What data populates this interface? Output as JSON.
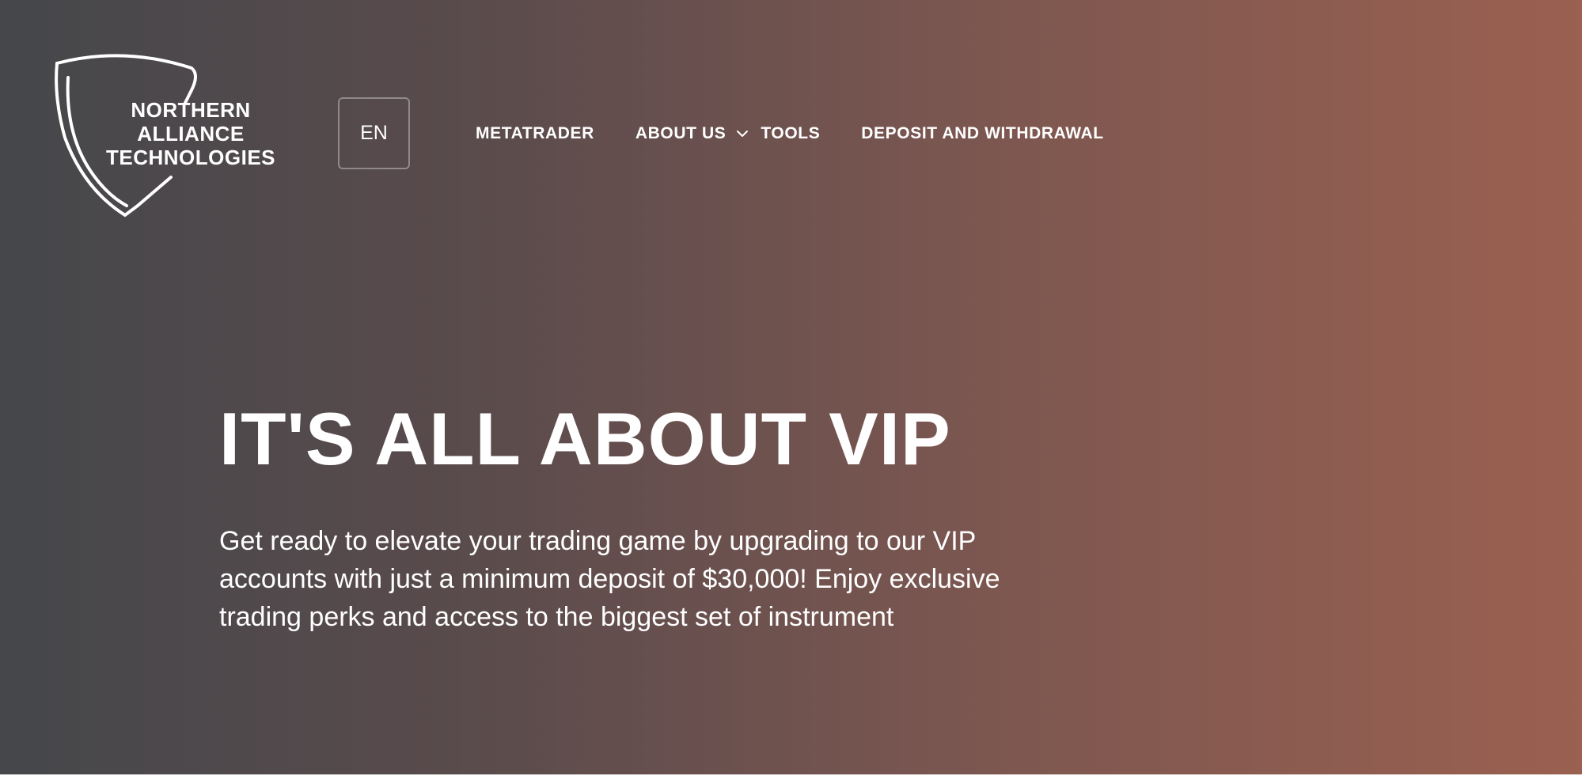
{
  "brand": {
    "lines": [
      "NORTHERN",
      "ALLIANCE",
      "TECHNOLOGIES"
    ],
    "icon": "shield-icon"
  },
  "language": {
    "label": "EN"
  },
  "nav": {
    "items": [
      {
        "label": "METATRADER"
      },
      {
        "label": "ABOUT US",
        "icon": "chevron-down-icon"
      },
      {
        "label": "TOOLS"
      },
      {
        "label": "DEPOSIT AND WITHDRAWAL"
      }
    ]
  },
  "hero": {
    "title": "IT'S ALL ABOUT VIP",
    "description": "Get ready to elevate your trading game by upgrading to our VIP accounts with just a minimum deposit of $30,000! Enjoy exclusive trading perks and access to the biggest set of instrument"
  },
  "colors": {
    "gradient_start": "#45474b",
    "gradient_end": "#9a6050",
    "text": "#ffffff"
  }
}
